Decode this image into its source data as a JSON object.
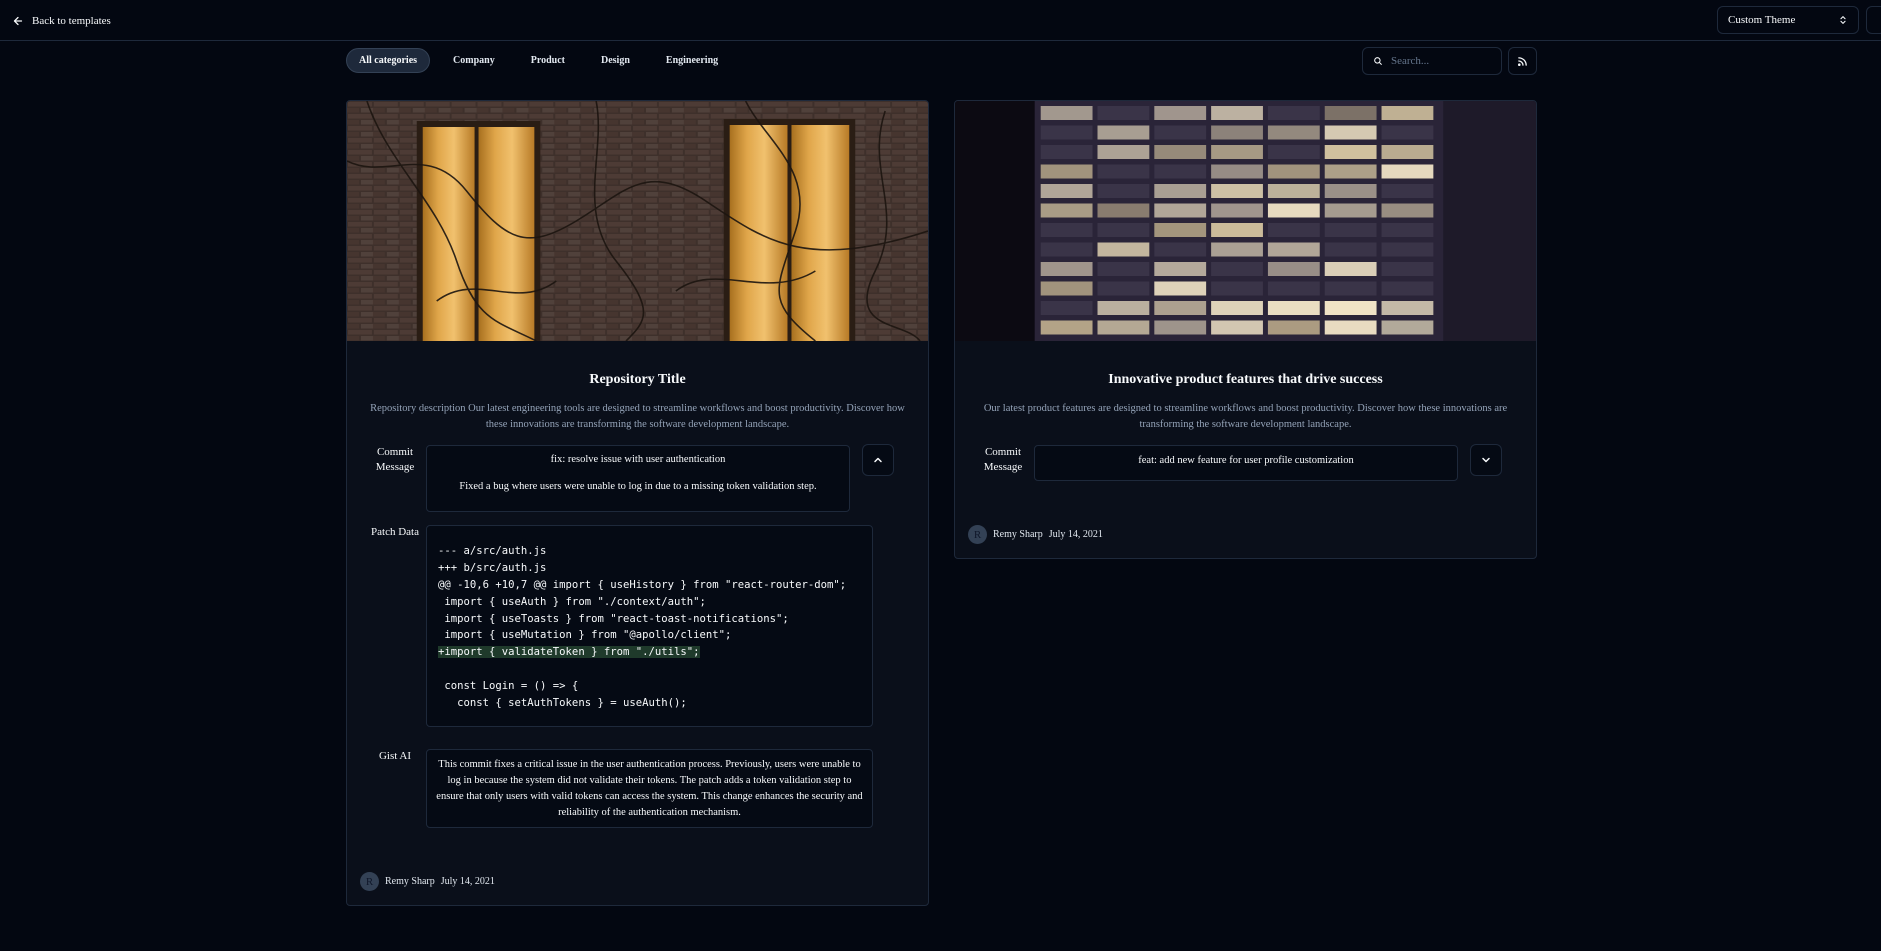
{
  "nav": {
    "back_label": "Back to templates",
    "theme_value": "Custom Theme"
  },
  "categories": [
    "All categories",
    "Company",
    "Product",
    "Design",
    "Engineering"
  ],
  "active_category": "All categories",
  "search": {
    "placeholder": "Search..."
  },
  "icons": {
    "back": "arrow-left-icon",
    "theme": "chevrons-up-down-icon",
    "search": "search-icon",
    "rss": "rss-icon",
    "collapse": "chevron-up-icon",
    "expand": "chevron-down-icon"
  },
  "cards": [
    {
      "title": "Repository Title",
      "description": "Repository description Our latest engineering tools are designed to streamline workflows and boost productivity. Discover how these innovations are transforming the software development landscape.",
      "commit_label": "Commit Message",
      "commit_title": "fix: resolve issue with user authentication",
      "commit_body": "Fixed a bug where users were unable to log in due to a missing token validation step.",
      "patch_label": "Patch Data",
      "patch_lines": [
        "--- a/src/auth.js",
        "+++ b/src/auth.js",
        "@@ -10,6 +10,7 @@ import { useHistory } from \"react-router-dom\";",
        " import { useAuth } from \"./context/auth\";",
        " import { useToasts } from \"react-toast-notifications\";",
        " import { useMutation } from \"@apollo/client\";",
        "+import { validateToken } from \"./utils\";",
        "",
        " const Login = () => {",
        "   const { setAuthTokens } = useAuth();"
      ],
      "gist_label": "Gist AI",
      "gist_text": "This commit fixes a critical issue in the user authentication process. Previously, users were unable to log in because the system did not validate their tokens. The patch adds a token validation step to ensure that only users with valid tokens can access the system. This change enhances the security and reliability of the authentication mechanism.",
      "author_initial": "R",
      "author_name": "Remy Sharp",
      "date": "July 14, 2021"
    },
    {
      "title": "Innovative product features that drive success",
      "description": "Our latest product features are designed to streamline workflows and boost productivity. Discover how these innovations are transforming the software development landscape.",
      "commit_label": "Commit Message",
      "commit_title": "feat: add new feature for user profile customization",
      "author_initial": "R",
      "author_name": "Remy Sharp",
      "date": "July 14, 2021"
    }
  ],
  "colors": {
    "background": "#030711",
    "border": "#1e293b",
    "muted_text": "#94a3b8",
    "diff_added_bg": "#1f3a2b"
  }
}
